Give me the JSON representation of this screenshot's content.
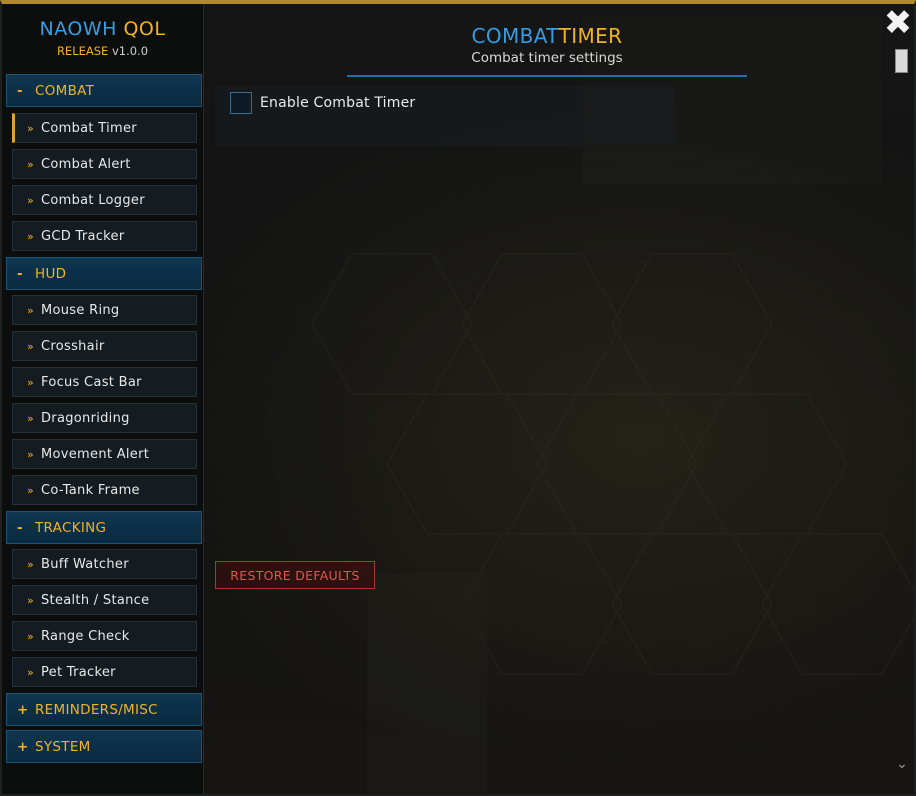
{
  "app": {
    "name_part1": "NAOWH",
    "name_part2": "QOL",
    "release_label": "RELEASE",
    "version": "v1.0.0"
  },
  "header": {
    "title_part1": "COMBAT",
    "title_part2": "TIMER",
    "subtitle": "Combat timer settings"
  },
  "sidebar": {
    "sections": [
      {
        "sign": "-",
        "label": "COMBAT",
        "items": [
          "Combat Timer",
          "Combat Alert",
          "Combat Logger",
          "GCD Tracker"
        ]
      },
      {
        "sign": "-",
        "label": "HUD",
        "items": [
          "Mouse Ring",
          "Crosshair",
          "Focus Cast Bar",
          "Dragonriding",
          "Movement Alert",
          "Co-Tank Frame"
        ]
      },
      {
        "sign": "-",
        "label": "TRACKING",
        "items": [
          "Buff Watcher",
          "Stealth / Stance",
          "Range Check",
          "Pet Tracker"
        ]
      },
      {
        "sign": "+",
        "label": "REMINDERS/MISC",
        "items": []
      },
      {
        "sign": "+",
        "label": "SYSTEM",
        "items": []
      }
    ],
    "item_chevron": "»"
  },
  "content": {
    "enable_label": "Enable Combat Timer",
    "enable_checked": false,
    "restore_label": "RESTORE DEFAULTS"
  },
  "controls": {
    "close_glyph": "✖",
    "scroll_down_glyph": "⌄"
  },
  "colors": {
    "accent_blue": "#3a9ce0",
    "accent_gold": "#f0b323",
    "danger_red": "#e2564a"
  }
}
